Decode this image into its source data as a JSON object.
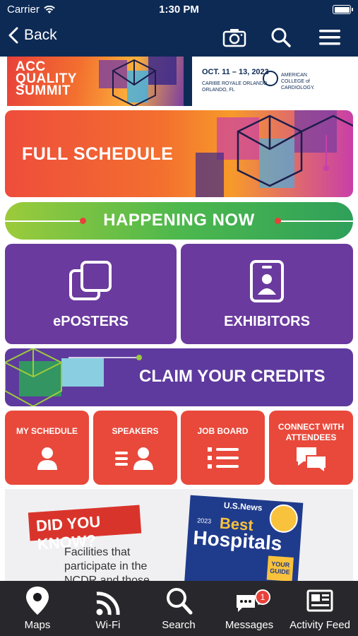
{
  "status_bar": {
    "carrier": "Carrier",
    "time": "1:30 PM"
  },
  "nav": {
    "back_label": "Back",
    "icons": [
      "camera-icon",
      "search-icon",
      "menu-icon"
    ]
  },
  "banner": {
    "title_line1": "ACC",
    "title_line2": "QUALITY",
    "title_line3": "SUMMIT",
    "date": "OCT. 11 – 13, 2023",
    "venue_line1": "CARIBE ROYALE ORLANDO",
    "venue_line2": "ORLANDO, FL",
    "org_line1": "AMERICAN",
    "org_line2": "COLLEGE of",
    "org_line3": "CARDIOLOGY."
  },
  "tiles": {
    "full_schedule": "FULL SCHEDULE",
    "happening_now": "HAPPENING NOW",
    "eposters": "ePOSTERS",
    "exhibitors": "EXHIBITORS",
    "claim_credits": "CLAIM YOUR CREDITS",
    "my_schedule": "MY SCHEDULE",
    "speakers": "SPEAKERS",
    "job_board": "JOB BOARD",
    "connect": "CONNECT WITH ATTENDEES"
  },
  "did_you_know": {
    "heading": "DID YOU KNOW?",
    "body": "Facilities that participate in the NCDR and those that have earned ACC Accreditation are featured here",
    "magazine_brand": "U.S.News",
    "magazine_year": "2023",
    "magazine_best": "Best",
    "magazine_title": "Hospitals",
    "magazine_guide": "YOUR GUIDE"
  },
  "tabbar": {
    "items": [
      {
        "label": "Maps",
        "icon": "map-pin-icon"
      },
      {
        "label": "Wi-Fi",
        "icon": "wifi-icon"
      },
      {
        "label": "Search",
        "icon": "search-icon"
      },
      {
        "label": "Messages",
        "icon": "messages-icon",
        "badge": "1"
      },
      {
        "label": "Activity Feed",
        "icon": "newspaper-icon"
      }
    ]
  },
  "colors": {
    "navy": "#0d2a55",
    "orange_red": "#e8493b",
    "purple": "#6a3a9e",
    "green": "#4db84d"
  }
}
